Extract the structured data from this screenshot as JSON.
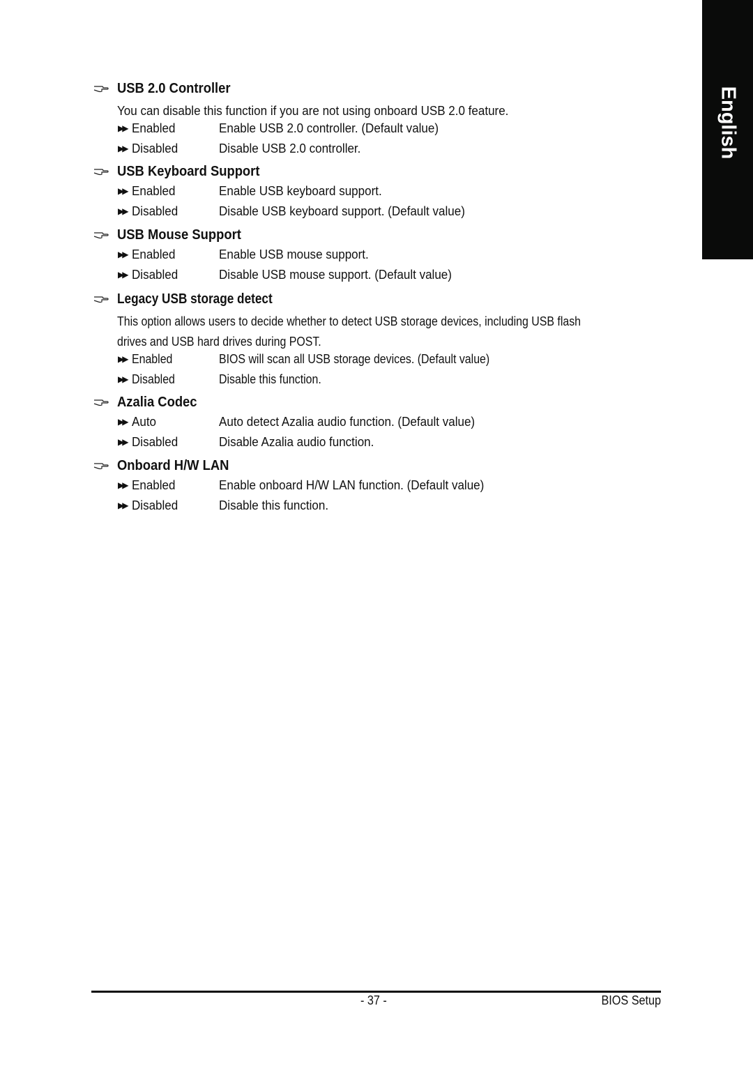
{
  "language_tab": "English",
  "sections": [
    {
      "title": "USB 2.0 Controller",
      "description": [
        "You can disable this function if you are not using onboard USB 2.0 feature."
      ],
      "options": [
        {
          "name": "Enabled",
          "text": "Enable USB 2.0 controller. (Default value)"
        },
        {
          "name": "Disabled",
          "text": "Disable USB 2.0 controller."
        }
      ]
    },
    {
      "title": "USB Keyboard Support",
      "description": [],
      "options": [
        {
          "name": "Enabled",
          "text": "Enable USB keyboard support."
        },
        {
          "name": "Disabled",
          "text": "Disable USB keyboard support. (Default value)"
        }
      ]
    },
    {
      "title": "USB Mouse Support",
      "description": [],
      "options": [
        {
          "name": "Enabled",
          "text": "Enable USB mouse support."
        },
        {
          "name": "Disabled",
          "text": "Disable USB mouse support. (Default value)"
        }
      ]
    },
    {
      "title": "Legacy USB storage detect",
      "description": [
        "This option allows users to decide whether to detect USB storage devices, including USB flash",
        "drives and USB hard drives during POST."
      ],
      "options": [
        {
          "name": "Enabled",
          "text": "BIOS will scan all USB storage devices. (Default value)"
        },
        {
          "name": "Disabled",
          "text": "Disable this function."
        }
      ]
    },
    {
      "title": "Azalia Codec",
      "description": [],
      "options": [
        {
          "name": "Auto",
          "text": "Auto detect Azalia audio function. (Default value)"
        },
        {
          "name": "Disabled",
          "text": "Disable Azalia audio function."
        }
      ]
    },
    {
      "title": "Onboard H/W LAN",
      "description": [],
      "options": [
        {
          "name": "Enabled",
          "text": "Enable onboard H/W LAN function. (Default value)"
        },
        {
          "name": "Disabled",
          "text": "Disable this function."
        }
      ]
    }
  ],
  "footer": {
    "page_number": "- 37 -",
    "section_title": "BIOS Setup"
  }
}
